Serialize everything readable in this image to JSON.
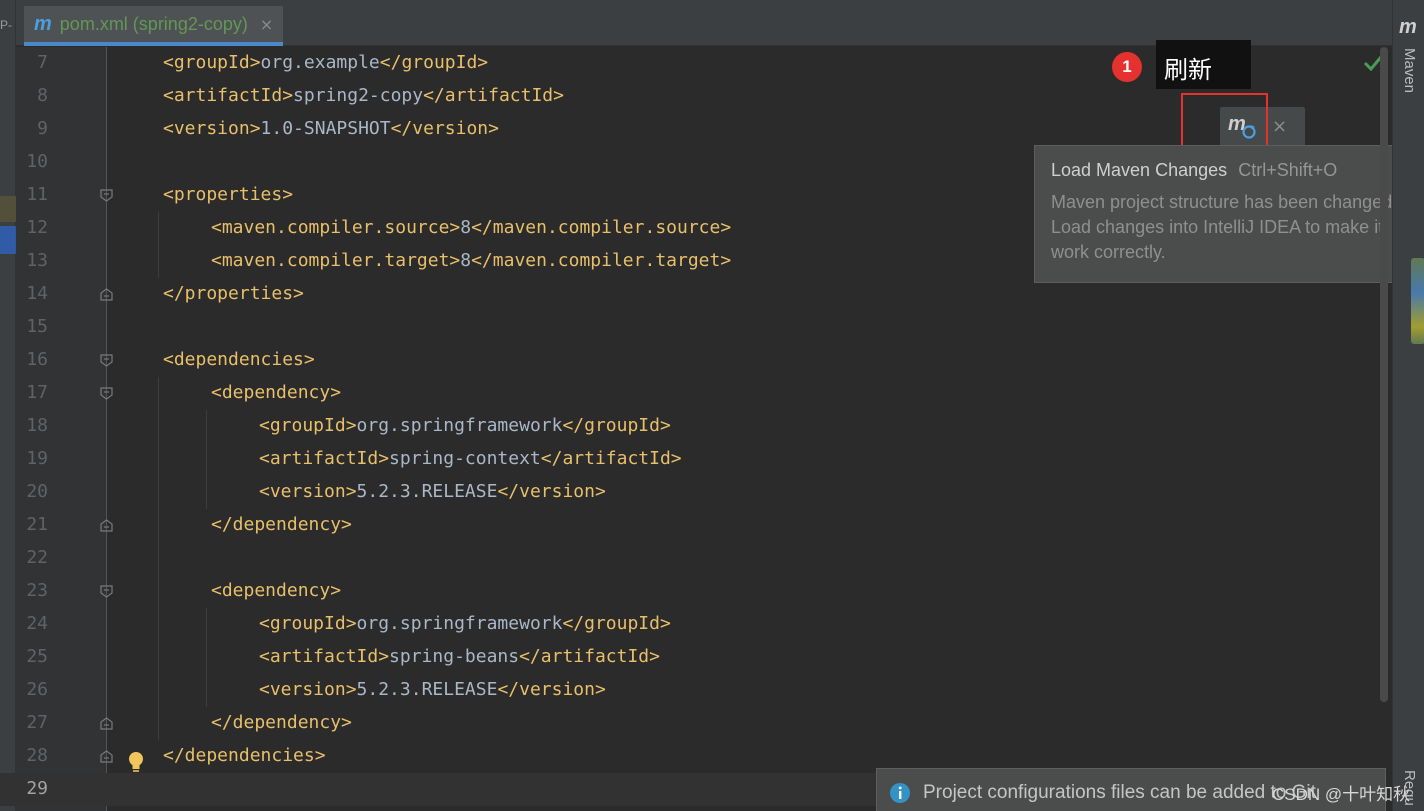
{
  "tab": {
    "file_name": "pom.xml (spring2-copy)",
    "icon": "maven-m-icon",
    "close": "×"
  },
  "left_strip": {
    "text_a": "P-",
    "text_b": ""
  },
  "editor": {
    "current_line": "29",
    "lines": [
      {
        "num": "7",
        "parts": [
          [
            "tag",
            "<groupId>"
          ],
          [
            "txt",
            "org.example"
          ],
          [
            "tag",
            "</groupId>"
          ]
        ]
      },
      {
        "num": "8",
        "parts": [
          [
            "tag",
            "<artifactId>"
          ],
          [
            "txt",
            "spring2-copy"
          ],
          [
            "tag",
            "</artifactId>"
          ]
        ]
      },
      {
        "num": "9",
        "parts": [
          [
            "tag",
            "<version>"
          ],
          [
            "txt",
            "1.0-SNAPSHOT"
          ],
          [
            "tag",
            "</version>"
          ]
        ]
      },
      {
        "num": "10",
        "parts": []
      },
      {
        "num": "11",
        "parts": [
          [
            "tag",
            "<properties>"
          ]
        ]
      },
      {
        "num": "12",
        "parts": [
          [
            "tag",
            "<maven.compiler.source>"
          ],
          [
            "txt",
            "8"
          ],
          [
            "tag",
            "</maven.compiler.source>"
          ]
        ]
      },
      {
        "num": "13",
        "parts": [
          [
            "tag",
            "<maven.compiler.target>"
          ],
          [
            "txt",
            "8"
          ],
          [
            "tag",
            "</maven.compiler.target>"
          ]
        ]
      },
      {
        "num": "14",
        "parts": [
          [
            "tag",
            "</properties>"
          ]
        ]
      },
      {
        "num": "15",
        "parts": []
      },
      {
        "num": "16",
        "parts": [
          [
            "tag",
            "<dependencies>"
          ]
        ]
      },
      {
        "num": "17",
        "parts": [
          [
            "tag",
            "<dependency>"
          ]
        ]
      },
      {
        "num": "18",
        "parts": [
          [
            "tag",
            "<groupId>"
          ],
          [
            "txt",
            "org.springframework"
          ],
          [
            "tag",
            "</groupId>"
          ]
        ]
      },
      {
        "num": "19",
        "parts": [
          [
            "tag",
            "<artifactId>"
          ],
          [
            "txt",
            "spring-context"
          ],
          [
            "tag",
            "</artifactId>"
          ]
        ]
      },
      {
        "num": "20",
        "parts": [
          [
            "tag",
            "<version>"
          ],
          [
            "txt",
            "5.2.3.RELEASE"
          ],
          [
            "tag",
            "</version>"
          ]
        ]
      },
      {
        "num": "21",
        "parts": [
          [
            "tag",
            "</dependency>"
          ]
        ]
      },
      {
        "num": "22",
        "parts": []
      },
      {
        "num": "23",
        "parts": [
          [
            "tag",
            "<dependency>"
          ]
        ]
      },
      {
        "num": "24",
        "parts": [
          [
            "tag",
            "<groupId>"
          ],
          [
            "txt",
            "org.springframework"
          ],
          [
            "tag",
            "</groupId>"
          ]
        ]
      },
      {
        "num": "25",
        "parts": [
          [
            "tag",
            "<artifactId>"
          ],
          [
            "txt",
            "spring-beans"
          ],
          [
            "tag",
            "</artifactId>"
          ]
        ]
      },
      {
        "num": "26",
        "parts": [
          [
            "tag",
            "<version>"
          ],
          [
            "txt",
            "5.2.3.RELEASE"
          ],
          [
            "tag",
            "</version>"
          ]
        ]
      },
      {
        "num": "27",
        "parts": [
          [
            "tag",
            "</dependency>"
          ]
        ]
      },
      {
        "num": "28",
        "parts": [
          [
            "tag",
            "</dependencies>"
          ]
        ]
      },
      {
        "num": "29",
        "parts": []
      }
    ]
  },
  "annotation": {
    "badge": "1",
    "label": "刷新"
  },
  "maven_float": {
    "close": "×"
  },
  "tooltip": {
    "title": "Load Maven Changes",
    "shortcut": "Ctrl+Shift+O",
    "body": "Maven project structure has been changed. Load changes into IntelliJ IDEA to make it work correctly."
  },
  "right_strip": {
    "maven_label": "Maven",
    "req_label": "Requ"
  },
  "notification": {
    "message": "Project configurations files can be added to Git"
  },
  "watermark": "CSDN @十叶知秋",
  "colors": {
    "tag": "#e8bf6a",
    "text": "#a9b7c6",
    "accent": "#4a88c7",
    "annotation": "#e5322e",
    "check": "#499c54"
  }
}
